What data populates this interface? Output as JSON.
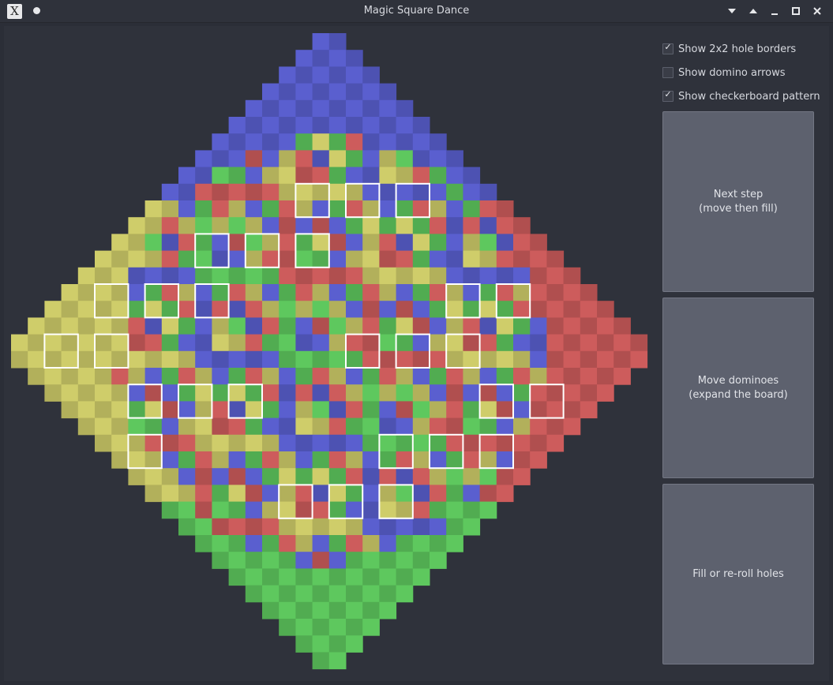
{
  "window": {
    "title": "Magic Square Dance",
    "app_icon_glyph": "X"
  },
  "options": [
    {
      "label": "Show 2x2 hole borders",
      "checked": true
    },
    {
      "label": "Show domino arrows",
      "checked": false
    },
    {
      "label": "Show checkerboard pattern",
      "checked": true
    }
  ],
  "buttons": {
    "next_step": {
      "line1": "Next step",
      "line2": "(move then fill)"
    },
    "move": {
      "line1": "Move dominoes",
      "line2": "(expand the board)"
    },
    "fill": {
      "line1": "Fill or re-roll holes"
    }
  },
  "colors": {
    "north": "#5a5fcf",
    "south": "#5ec85e",
    "east": "#cd5c5c",
    "west": "#cfcd6a",
    "hole_border": "#ffffff"
  }
}
